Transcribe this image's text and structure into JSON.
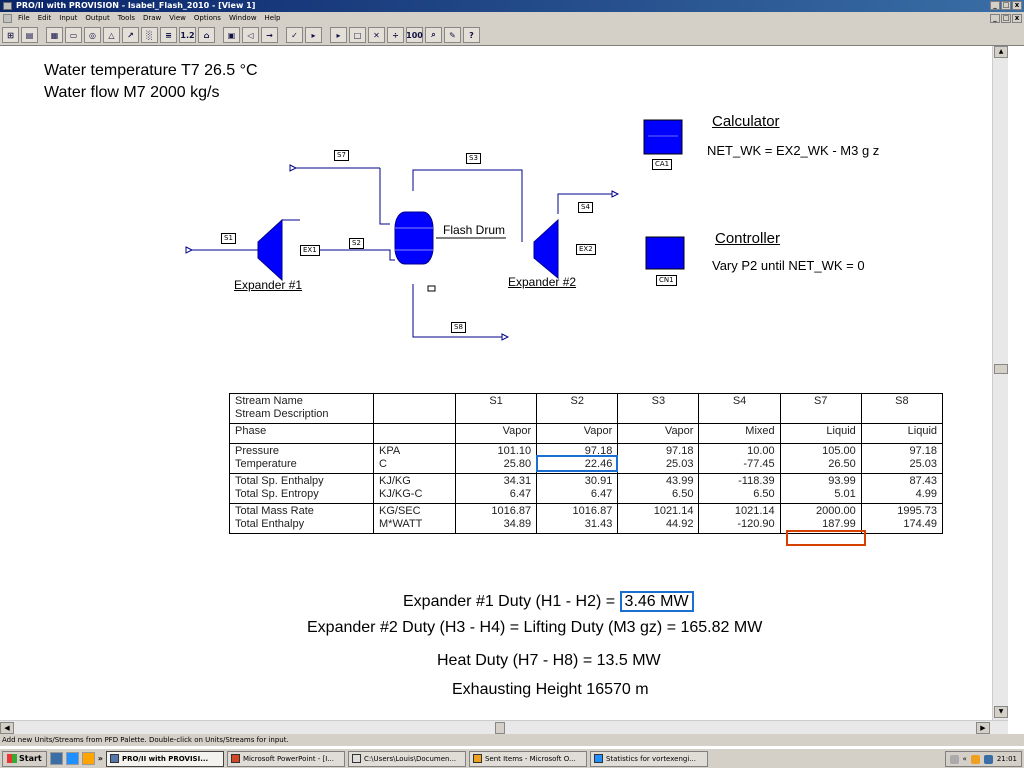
{
  "window": {
    "title": "PRO/II with PROVISION - Isabel_Flash_2010 - [View 1]",
    "min": "_",
    "max": "□",
    "close": "x"
  },
  "menu": [
    "File",
    "Edit",
    "Input",
    "Output",
    "Tools",
    "Draw",
    "View",
    "Options",
    "Window",
    "Help"
  ],
  "toolbar": {
    "labels": [
      "⊞",
      "▤",
      "▦",
      "▭",
      "◎",
      "△",
      "↗",
      "░",
      "≡",
      "1.2",
      "⌂",
      "▣",
      "◁",
      "→",
      "✓",
      "▸",
      "□",
      "✕",
      "÷",
      "100",
      "⌕",
      "✎",
      "?"
    ]
  },
  "headings": {
    "line1": "Water temperature T7 26.5 °C",
    "line2": "Water flow M7 2000 kg/s"
  },
  "flowsheet": {
    "streams": [
      "S1",
      "S2",
      "S3",
      "S4",
      "S7",
      "S8"
    ],
    "units": {
      "ex1": "EX1",
      "ex2": "EX2",
      "ca1": "CA1",
      "cn1": "CN1"
    },
    "labels": {
      "expander1": "Expander #1",
      "expander2": "Expander #2",
      "flash_drum": "Flash Drum",
      "calculator": "Calculator",
      "calc_eq": "NET_WK = EX2_WK - M3 g z",
      "controller": "Controller",
      "ctrl_eq": "Vary P2 until NET_WK = 0"
    }
  },
  "table": {
    "headers": [
      "S1",
      "S2",
      "S3",
      "S4",
      "S7",
      "S8"
    ],
    "rows": [
      {
        "name": [
          "Stream Name",
          "Stream Description"
        ],
        "unit": [
          "",
          ""
        ],
        "vals": [
          [
            "S1",
            ""
          ],
          [
            "S2",
            ""
          ],
          [
            "S3",
            ""
          ],
          [
            "S4",
            ""
          ],
          [
            "S7",
            ""
          ],
          [
            "S8",
            ""
          ]
        ]
      },
      {
        "name": [
          "Phase"
        ],
        "unit": [
          ""
        ],
        "vals": [
          [
            "Vapor"
          ],
          [
            "Vapor"
          ],
          [
            "Vapor"
          ],
          [
            "Mixed"
          ],
          [
            "Liquid"
          ],
          [
            "Liquid"
          ]
        ]
      },
      {
        "name": [
          "Pressure",
          "Temperature"
        ],
        "unit": [
          "KPA",
          "C"
        ],
        "vals": [
          [
            "101.10",
            "25.80"
          ],
          [
            "97.18",
            "22.46"
          ],
          [
            "97.18",
            "25.03"
          ],
          [
            "10.00",
            "-77.45"
          ],
          [
            "105.00",
            "26.50"
          ],
          [
            "97.18",
            "25.03"
          ]
        ]
      },
      {
        "name": [
          "Total Sp. Enthalpy",
          "Total Sp. Entropy"
        ],
        "unit": [
          "KJ/KG",
          "KJ/KG-C"
        ],
        "vals": [
          [
            "34.31",
            "6.47"
          ],
          [
            "30.91",
            "6.47"
          ],
          [
            "43.99",
            "6.50"
          ],
          [
            "-118.39",
            "6.50"
          ],
          [
            "93.99",
            "5.01"
          ],
          [
            "87.43",
            "4.99"
          ]
        ]
      },
      {
        "name": [
          "Total Mass Rate",
          "Total Enthalpy"
        ],
        "unit": [
          "KG/SEC",
          "M*WATT"
        ],
        "vals": [
          [
            "1016.87",
            "34.89"
          ],
          [
            "1016.87",
            "31.43"
          ],
          [
            "1021.14",
            "44.92"
          ],
          [
            "1021.14",
            "-120.90"
          ],
          [
            "2000.00",
            "187.99"
          ],
          [
            "1995.73",
            "174.49"
          ]
        ]
      }
    ]
  },
  "results": {
    "line1_prefix": "Expander #1 Duty  (H1 - H2) = ",
    "line1_value": "3.46 MW",
    "line2": "Expander #2 Duty  (H3 - H4) = Lifting Duty (M3 gz) =  165.82 MW",
    "line3": "Heat Duty (H7 - H8) = 13.5 MW",
    "line4": "Exhausting Height 16570 m"
  },
  "status": "Add new Units/Streams from PFD Palette.  Double-click on Units/Streams for input.",
  "taskbar": {
    "start": "Start",
    "chevron": "»",
    "tasks": [
      {
        "label": "PRO/II with PROVISI...",
        "active": true
      },
      {
        "label": "Microsoft PowerPoint - [I...",
        "active": false
      },
      {
        "label": "C:\\Users\\Louis\\Documen...",
        "active": false
      },
      {
        "label": "Sent Items - Microsoft O...",
        "active": false
      },
      {
        "label": "Statistics for vortexengi...",
        "active": false
      }
    ],
    "tray_chevron": "«",
    "clock": "21:01"
  },
  "colors": {
    "unit_blue": "#0000ff",
    "pipe": "#00008b",
    "highlight_blue": "#1a6fd0",
    "highlight_red": "#d64000"
  }
}
